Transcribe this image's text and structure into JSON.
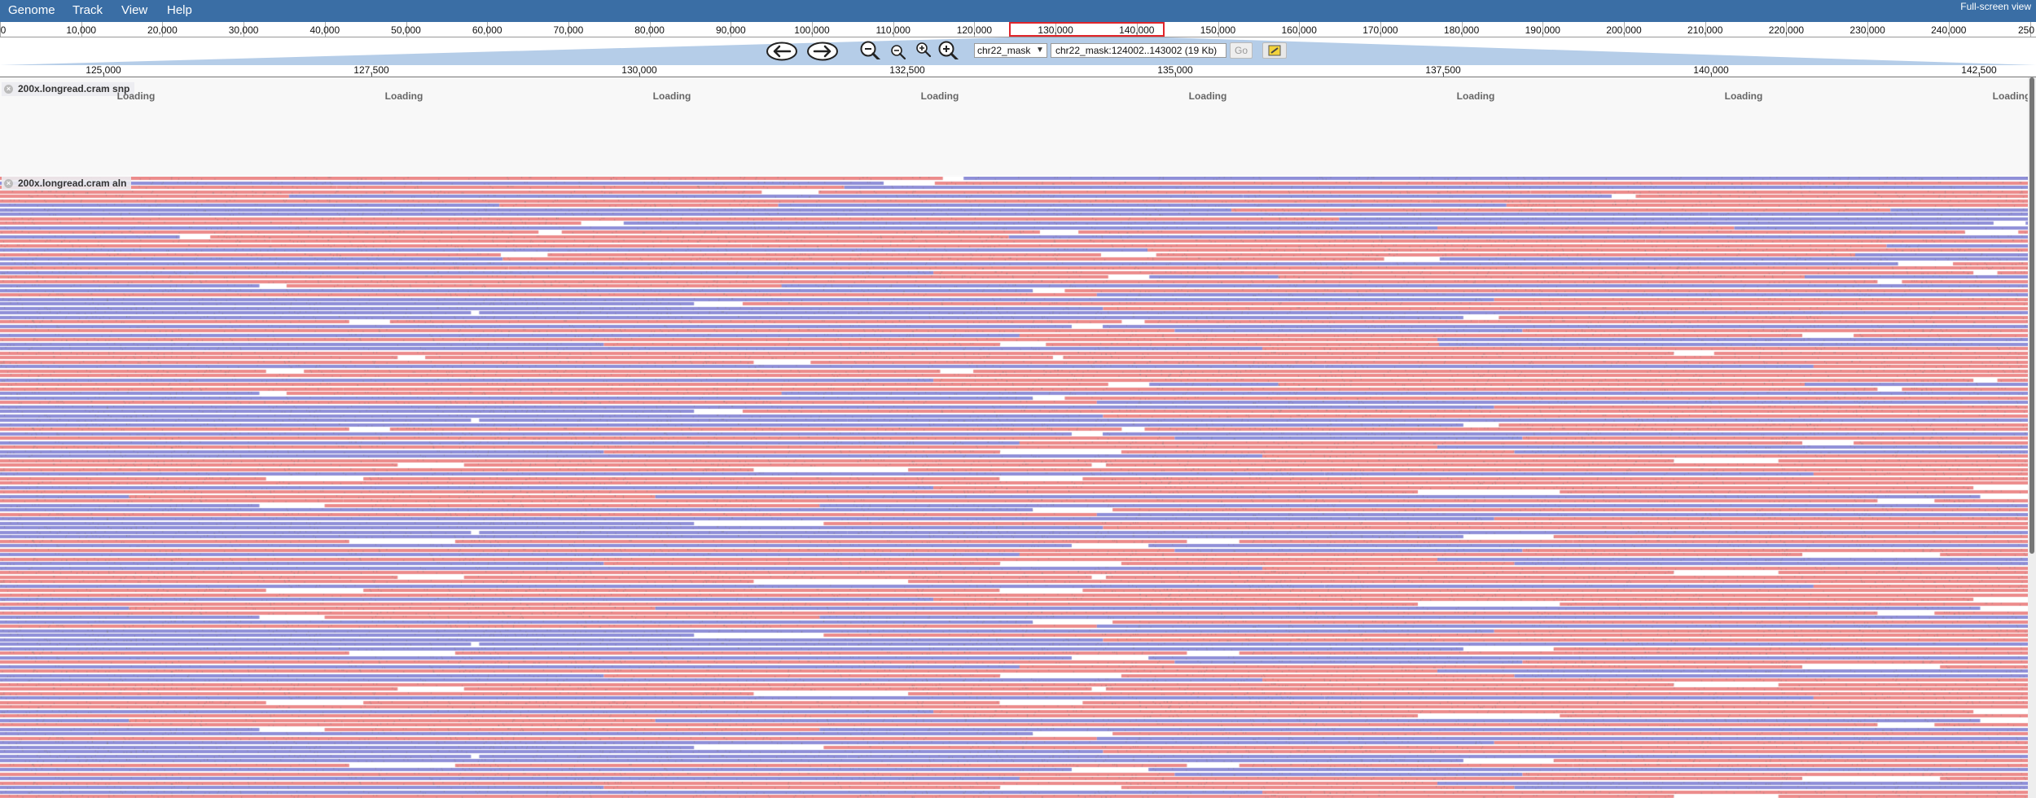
{
  "menu": {
    "items": [
      {
        "id": "genome",
        "label": "Genome"
      },
      {
        "id": "track",
        "label": "Track"
      },
      {
        "id": "view",
        "label": "View"
      },
      {
        "id": "help",
        "label": "Help"
      }
    ],
    "fullscreen_label": "Full-screen view"
  },
  "overview": {
    "tick_labels": [
      "0",
      "10,000",
      "20,000",
      "30,000",
      "40,000",
      "50,000",
      "60,000",
      "70,000",
      "80,000",
      "90,000",
      "100,000",
      "110,000",
      "120,000",
      "130,000",
      "140,000",
      "150,000",
      "160,000",
      "170,000",
      "180,000",
      "190,000",
      "200,000",
      "210,000",
      "220,000",
      "230,000",
      "240,000",
      "250"
    ],
    "highlight_start": 124002,
    "highlight_end": 143002
  },
  "navigation": {
    "refseq_value": "chr22_mask",
    "location_value": "chr22_mask:124002..143002 (19 Kb)",
    "go_label": "Go"
  },
  "scale": {
    "tick_labels": [
      "125,000",
      "127,500",
      "130,000",
      "132,500",
      "135,000",
      "137,500",
      "140,000",
      "142,500"
    ]
  },
  "tracks": [
    {
      "id": "snp",
      "label": "200x.longread.cram snp",
      "loading_label": "Loading",
      "loading_count": 8
    },
    {
      "id": "aln",
      "label": "200x.longread.cram aln"
    }
  ],
  "colors": {
    "menubar": "#3a6ea5",
    "forward_read": "#ec8b8b",
    "reverse_read": "#8f8fd8",
    "highlight_box": "#e0252b"
  }
}
